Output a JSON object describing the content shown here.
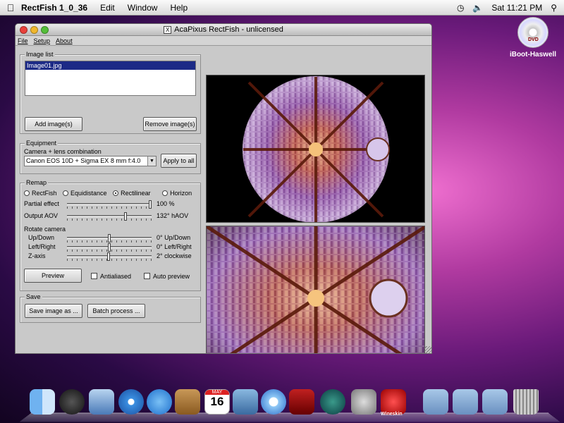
{
  "menubar": {
    "apple_icon": "apple-logo",
    "app_name": "RectFish 1_0_36",
    "menus": [
      "Edit",
      "Window",
      "Help"
    ],
    "clock": "Sat 11:21 PM"
  },
  "desktop": {
    "drive_label": "iBoot-Haswell",
    "dvd_text": "DVD"
  },
  "window": {
    "title": "AcaPixus RectFish - unlicensed",
    "title_icon": "X",
    "menu": [
      "File",
      "Setup",
      "About"
    ],
    "image_list": {
      "label": "Image list",
      "items": [
        "Image01.jpg"
      ],
      "add_button": "Add image(s)",
      "remove_button": "Remove image(s)"
    },
    "equipment": {
      "label": "Equipment",
      "combo_label": "Camera + lens combination",
      "combo_value": "Canon EOS 10D + Sigma EX 8 mm f:4.0",
      "apply_button": "Apply to all"
    },
    "remap": {
      "label": "Remap",
      "options": [
        "RectFish",
        "Equidistance",
        "Rectilinear",
        "Horizon"
      ],
      "selected": "Rectilinear",
      "partial_label": "Partial effect",
      "partial_value": "100 %",
      "partial_level": 1.0,
      "aov_label": "Output AOV",
      "aov_value": "132° hAOV",
      "aov_level": 0.7,
      "rotate_label": "Rotate camera",
      "updown_label": "Up/Down",
      "updown_value": "0° Up/Down",
      "updown_level": 0.5,
      "leftright_label": "Left/Right",
      "leftright_value": "0° Left/Right",
      "leftright_level": 0.5,
      "zaxis_label": "Z-axis",
      "zaxis_value": "2° clockwise",
      "zaxis_level": 0.49,
      "preview_button": "Preview",
      "antialiased_label": "Antialiased",
      "autopreview_label": "Auto preview"
    },
    "save": {
      "label": "Save",
      "save_button": "Save image as ...",
      "batch_button": "Batch process ..."
    }
  },
  "dock": {
    "items": [
      "finder-icon",
      "dashboard-icon",
      "mail-icon",
      "safari-icon",
      "ichat-icon",
      "addressbook-icon",
      "ical-icon",
      "iphoto-icon",
      "itunes-icon",
      "photobooth-icon",
      "timemachine-icon",
      "systemprefs-icon",
      "wineskin-icon",
      "applications-folder-icon",
      "documents-folder-icon",
      "downloads-folder-icon",
      "trash-icon"
    ],
    "ical_month": "MAY",
    "ical_day": "16",
    "wineskin_label": "Wineskin"
  },
  "colors": {
    "selection": "#1c2a86",
    "list_bg": "#ffffff",
    "window_bg": "#c9c9c9"
  }
}
